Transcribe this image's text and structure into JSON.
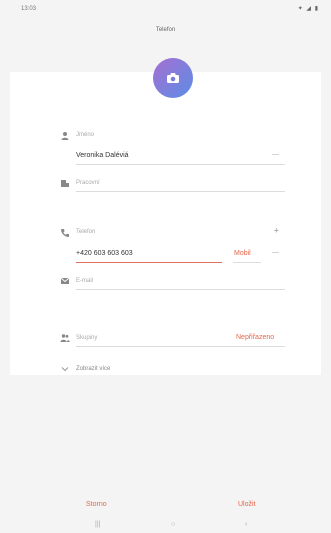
{
  "status": {
    "time": "13:03",
    "icons": "✦ ◢ ▮"
  },
  "screen": {
    "title": "Telefon"
  },
  "form": {
    "name_label": "Jméno",
    "name_value": "Veronika Daléviá",
    "org_label": "Pracovní",
    "phone_label": "Telefon",
    "phone_add": "+",
    "phone_value": "+420 603 603 603",
    "phone_type": "Mobil",
    "email_label": "E-mail",
    "groups_label": "Skupiny",
    "groups_value": "Nepřiřazeno",
    "more_label": "Zobrazit více",
    "remove_symbol": "—"
  },
  "actions": {
    "cancel": "Storno",
    "save": "Uložit"
  },
  "navbar": {
    "recent": "|||",
    "home": "○",
    "back": "‹"
  },
  "colors": {
    "accent": "#e4674a",
    "add": "#5ab566",
    "background": "#f4f4f4",
    "card": "#ffffff"
  }
}
